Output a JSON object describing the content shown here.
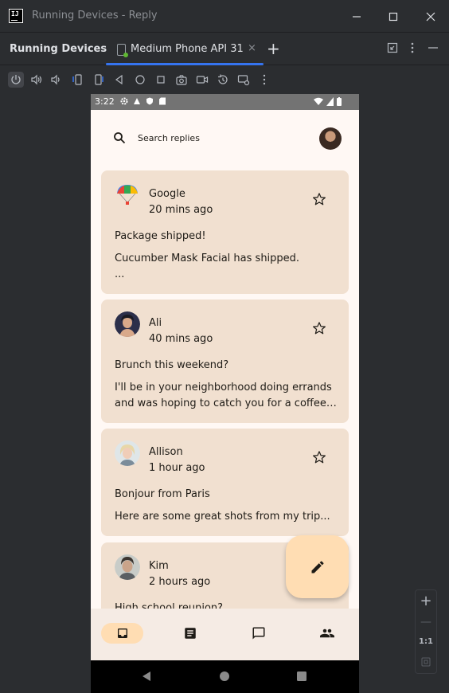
{
  "window": {
    "title": "Running Devices - Reply",
    "minimize": "—",
    "maximize": "☐",
    "close": "✕"
  },
  "tabbar": {
    "tool_window_title": "Running Devices",
    "tab_label": "Medium Phone API 31",
    "tab_close": "×",
    "add_tab": "+"
  },
  "device": {
    "status_time": "3:22",
    "search_placeholder": "Search replies",
    "emails": [
      {
        "sender": "Google",
        "time": "20 mins ago",
        "subject": "Package shipped!",
        "body_line1": "Cucumber Mask Facial has shipped.",
        "body_line2": "..."
      },
      {
        "sender": "Ali",
        "time": "40 mins ago",
        "subject": "Brunch this weekend?",
        "body_line1": "I'll be in your neighborhood doing errands",
        "body_line2": "and was hoping to catch you for a coffee t..."
      },
      {
        "sender": "Allison",
        "time": "1 hour ago",
        "subject": "Bonjour from Paris",
        "body_line1": "Here are some great shots from my trip...",
        "body_line2": ""
      },
      {
        "sender": "Kim",
        "time": "2 hours ago",
        "subject": "High school reunion?",
        "body_line1": "",
        "body_line2": ""
      }
    ]
  },
  "zoom": {
    "zoom_in": "+",
    "zoom_out": "—",
    "actual_size": "1:1"
  },
  "colors": {
    "card_bg": "#f1e0d0",
    "fab_bg": "#ffddb3",
    "accent_tab": "#3574f0",
    "ide_bg": "#2b2d30"
  }
}
